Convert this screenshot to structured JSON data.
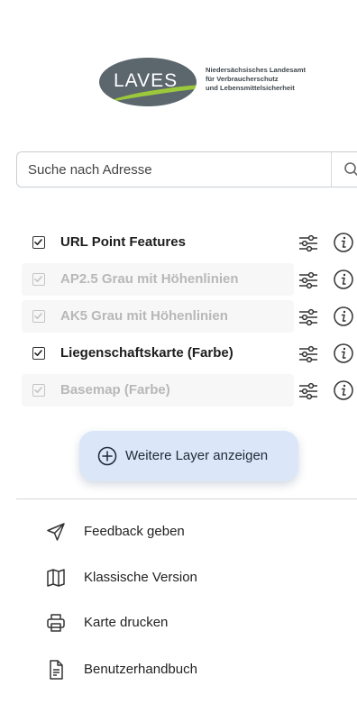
{
  "logo": {
    "mark": "LAVES",
    "org_line1": "Niedersächsisches Landesamt",
    "org_line2": "für Verbraucherschutz",
    "org_line3": "und Lebensmittelsicherheit"
  },
  "search": {
    "placeholder": "Suche nach Adresse",
    "icon": "search-icon"
  },
  "layers": [
    {
      "name": "URL Point Features",
      "checked": true,
      "active": true
    },
    {
      "name": "AP2.5 Grau mit Höhenlinien",
      "checked": true,
      "active": false
    },
    {
      "name": "AK5 Grau mit Höhenlinien",
      "checked": true,
      "active": false
    },
    {
      "name": "Liegenschaftskarte (Farbe)",
      "checked": true,
      "active": true
    },
    {
      "name": "Basemap (Farbe)",
      "checked": true,
      "active": false
    }
  ],
  "layer_icons": {
    "settings": "tune-icon",
    "info": "info-icon"
  },
  "more_layers": {
    "label": "Weitere Layer anzeigen",
    "icon": "plus-circle-icon"
  },
  "menu": [
    {
      "label": "Feedback geben",
      "icon": "send-icon"
    },
    {
      "label": "Klassische Version",
      "icon": "map-icon"
    },
    {
      "label": "Karte drucken",
      "icon": "printer-icon"
    },
    {
      "label": "Benutzerhandbuch",
      "icon": "document-icon"
    }
  ],
  "colors": {
    "logo_gray": "#5b666d",
    "logo_green": "#9cc83b",
    "button_bg": "#dbe7f8",
    "inactive_text": "#b8b8b8"
  }
}
